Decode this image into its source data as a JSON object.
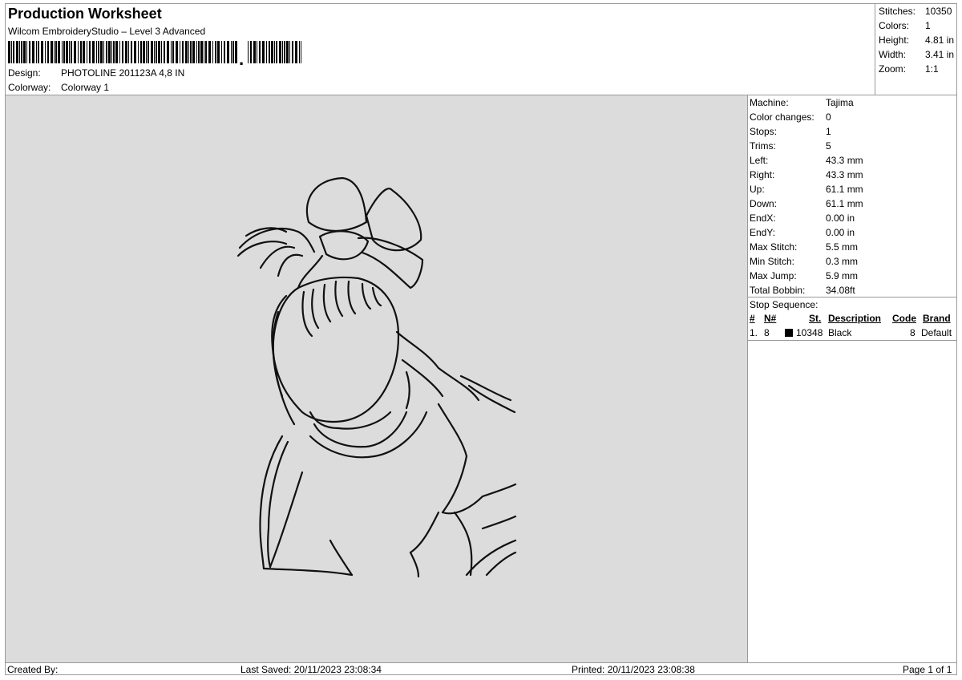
{
  "header": {
    "title": "Production Worksheet",
    "subtitle": "Wilcom EmbroideryStudio – Level 3 Advanced",
    "design_label": "Design:",
    "design_value": "PHOTOLINE 201123A 4,8 IN",
    "colorway_label": "Colorway:",
    "colorway_value": "Colorway 1"
  },
  "summary": {
    "stitches_label": "Stitches:",
    "stitches": "10350",
    "colors_label": "Colors:",
    "colors": "1",
    "height_label": "Height:",
    "height": "4.81 in",
    "width_label": "Width:",
    "width": "3.41 in",
    "zoom_label": "Zoom:",
    "zoom": "1:1"
  },
  "details": [
    {
      "label": "Machine:",
      "value": "Tajima"
    },
    {
      "label": "Color changes:",
      "value": "0"
    },
    {
      "label": "Stops:",
      "value": "1"
    },
    {
      "label": "Trims:",
      "value": "5"
    },
    {
      "label": "Left:",
      "value": "43.3 mm"
    },
    {
      "label": "Right:",
      "value": "43.3 mm"
    },
    {
      "label": "Up:",
      "value": "61.1 mm"
    },
    {
      "label": "Down:",
      "value": "61.1 mm"
    },
    {
      "label": "EndX:",
      "value": "0.00 in"
    },
    {
      "label": "EndY:",
      "value": "0.00 in"
    },
    {
      "label": "Max Stitch:",
      "value": "5.5 mm"
    },
    {
      "label": "Min Stitch:",
      "value": "0.3 mm"
    },
    {
      "label": "Max Jump:",
      "value": "5.9 mm"
    },
    {
      "label": "Total Bobbin:",
      "value": "34.08ft"
    }
  ],
  "stop_sequence": {
    "title": "Stop Sequence:",
    "headers": {
      "num": "#",
      "n": "N#",
      "st": "St.",
      "description": "Description",
      "code": "Code",
      "brand": "Brand"
    },
    "rows": [
      {
        "num": "1.",
        "n": "8",
        "color": "#000000",
        "st": "10348",
        "description": "Black",
        "code": "8",
        "brand": "Default"
      }
    ]
  },
  "footer": {
    "created_by": "Created By:",
    "last_saved": "Last Saved: 20/11/2023 23:08:34",
    "printed": "Printed: 20/11/2023 23:08:38",
    "page": "Page 1 of 1"
  }
}
